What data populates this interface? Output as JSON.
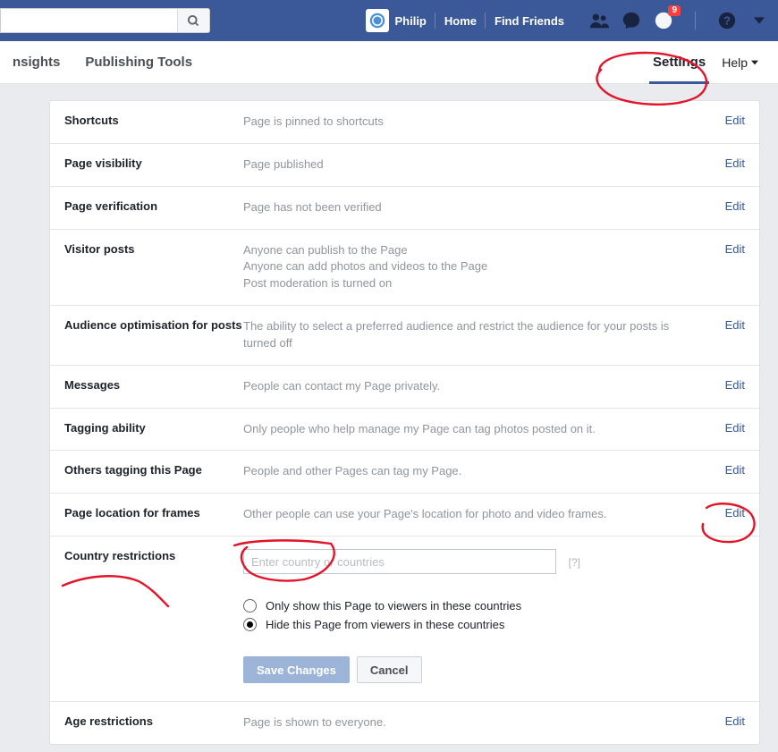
{
  "topbar": {
    "search_placeholder": "",
    "username": "Philip",
    "home": "Home",
    "find_friends": "Find Friends",
    "notif_count": "9"
  },
  "tabs": {
    "insights": "nsights",
    "publishing": "Publishing Tools",
    "settings": "Settings",
    "help": "Help"
  },
  "rows": {
    "shortcuts": {
      "label": "Shortcuts",
      "value": "Page is pinned to shortcuts",
      "edit": "Edit"
    },
    "visibility": {
      "label": "Page visibility",
      "value": "Page published",
      "edit": "Edit"
    },
    "verification": {
      "label": "Page verification",
      "value": "Page has not been verified",
      "edit": "Edit"
    },
    "visitor": {
      "label": "Visitor posts",
      "l1": "Anyone can publish to the Page",
      "l2": "Anyone can add photos and videos to the Page",
      "l3": "Post moderation is turned on",
      "edit": "Edit"
    },
    "audience": {
      "label": "Audience optimisation for posts",
      "value": "The ability to select a preferred audience and restrict the audience for your posts is turned off",
      "edit": "Edit"
    },
    "messages": {
      "label": "Messages",
      "value": "People can contact my Page privately.",
      "edit": "Edit"
    },
    "tagging": {
      "label": "Tagging ability",
      "value": "Only people who help manage my Page can tag photos posted on it.",
      "edit": "Edit"
    },
    "others_tagging": {
      "label": "Others tagging this Page",
      "value": "People and other Pages can tag my Page.",
      "edit": "Edit"
    },
    "location": {
      "label": "Page location for frames",
      "value": "Other people can use your Page's location for photo and video frames.",
      "edit": "Edit"
    },
    "country": {
      "label": "Country restrictions",
      "placeholder": "Enter country or countries",
      "help": "[?]",
      "opt_show": "Only show this Page to viewers in these countries",
      "opt_hide": "Hide this Page from viewers in these countries",
      "save": "Save Changes",
      "cancel": "Cancel"
    },
    "age": {
      "label": "Age restrictions",
      "value": "Page is shown to everyone.",
      "edit": "Edit"
    }
  }
}
